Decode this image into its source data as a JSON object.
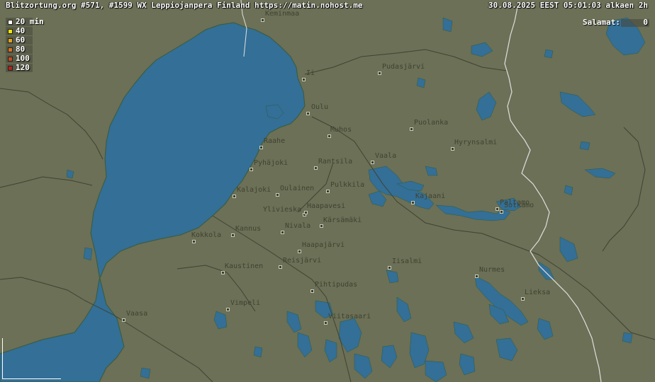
{
  "header": {
    "title": "Blitzortung.org #571, #1599 WX Leppiojanpera Finland https://matin.nohost.me",
    "datetime": "30.08.2025 EEST 05:01:03 alkaen 2h"
  },
  "counter": {
    "label": "Salamat:",
    "value": "0"
  },
  "legend": [
    {
      "label": "20 min",
      "color": "#ffffff"
    },
    {
      "label": "40",
      "color": "#f2e600"
    },
    {
      "label": "60",
      "color": "#e3a11c"
    },
    {
      "label": "80",
      "color": "#d27223"
    },
    {
      "label": "100",
      "color": "#c64a20"
    },
    {
      "label": "120",
      "color": "#b4231d"
    }
  ],
  "colors": {
    "land": "#6b7056",
    "water": "#336f96",
    "border": "#d8d8d8",
    "region_line": "#3f4232"
  },
  "towns": [
    "Keminmaa",
    "Ii",
    "Pudasjärvi",
    "Oulu",
    "Muhos",
    "Puolanka",
    "Raahe",
    "Hyrynsalmi",
    "Vaala",
    "Pyhäjoki",
    "Rantsila",
    "Kalajoki",
    "Oulainen",
    "Pulkkila",
    "Paltamo",
    "Kajaani",
    "Sotkamo",
    "Ylivieska",
    "Haapavesi",
    "Nivala",
    "Kärsämäki",
    "Kokkola",
    "Kannus",
    "Haapajärvi",
    "Kaustinen",
    "Reisjärvi",
    "Iisalmi",
    "Nurmes",
    "Pihtipudas",
    "Lieksa",
    "Vimpeli",
    "Vaasa",
    "Viitasaari"
  ]
}
